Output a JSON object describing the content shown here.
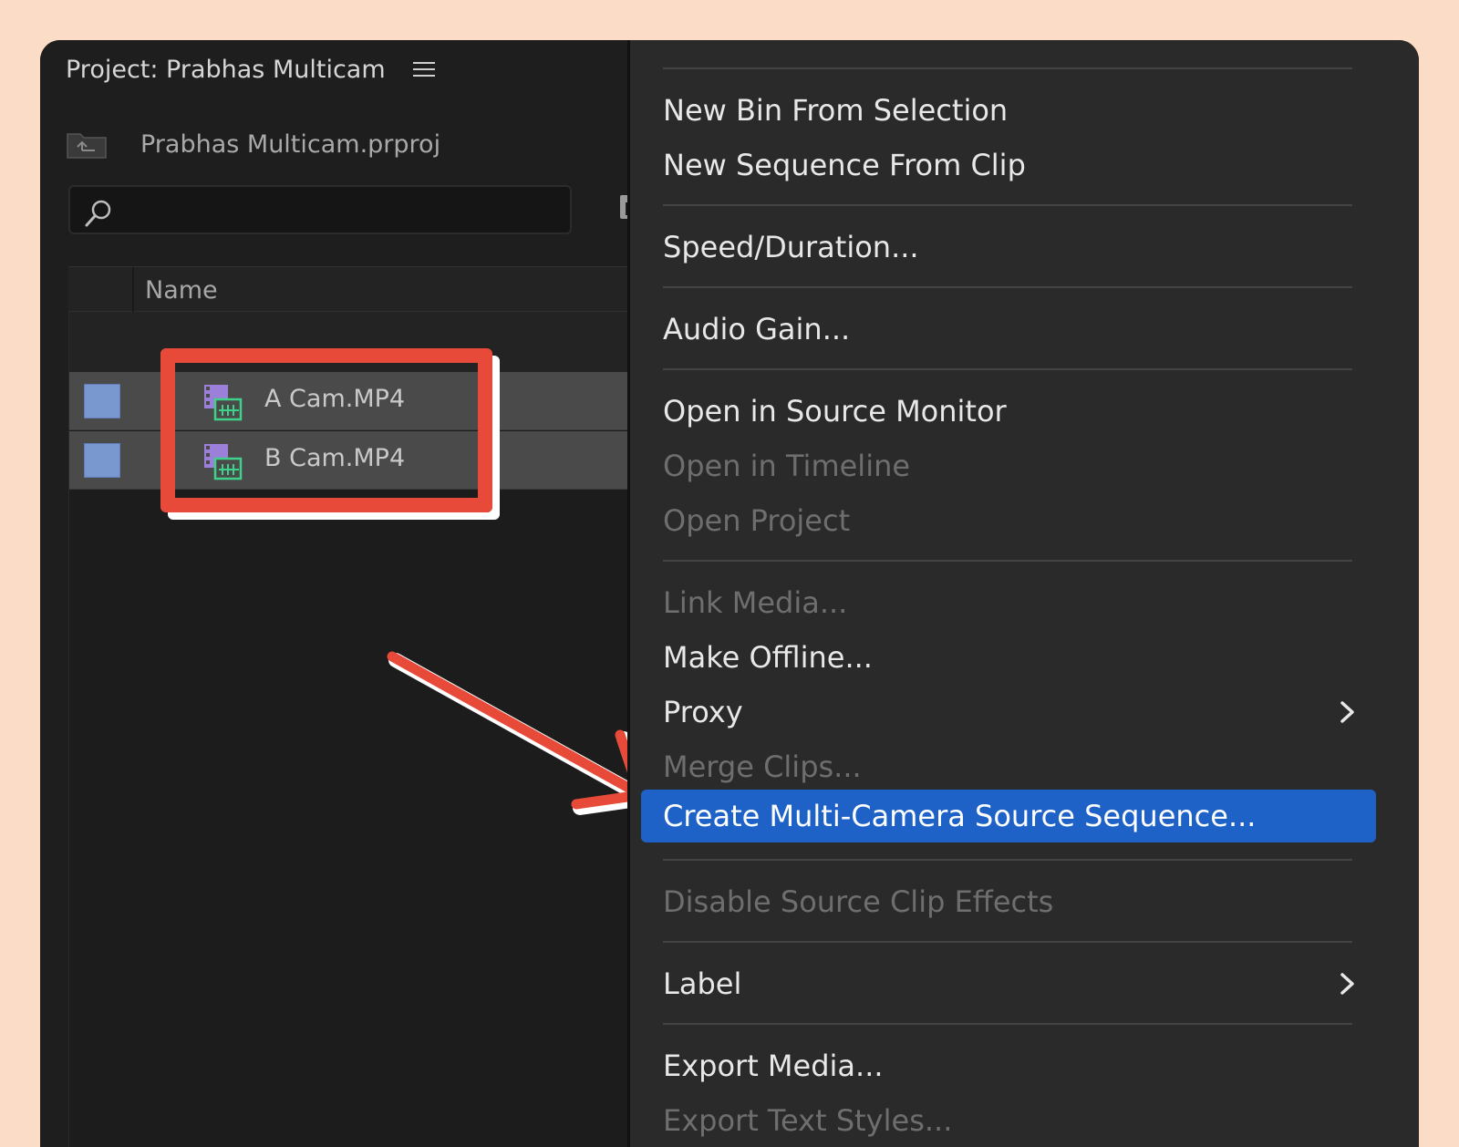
{
  "panel": {
    "title": "Project: Prabhas Multicam",
    "menu_icon": "hamburger-icon",
    "path": "Prabhas Multicam.prproj",
    "folder_icon": "folder-up-icon",
    "search_icon": "search-icon",
    "search_value": "",
    "column_name": "Name",
    "clips": [
      {
        "name": "A Cam.MP4",
        "label_color": "#7a98d0",
        "icon": "video-clip-icon"
      },
      {
        "name": "B Cam.MP4",
        "label_color": "#7a98d0",
        "icon": "video-clip-icon"
      }
    ]
  },
  "menu": {
    "items": [
      {
        "label": "New Bin From Selection",
        "enabled": true
      },
      {
        "label": "New Sequence From Clip",
        "enabled": true
      },
      {
        "label": "Speed/Duration...",
        "enabled": true
      },
      {
        "label": "Audio Gain...",
        "enabled": true
      },
      {
        "label": "Open in Source Monitor",
        "enabled": true
      },
      {
        "label": "Open in Timeline",
        "enabled": false
      },
      {
        "label": "Open Project",
        "enabled": false
      },
      {
        "label": "Link Media...",
        "enabled": false
      },
      {
        "label": "Make Offline...",
        "enabled": true
      },
      {
        "label": "Proxy",
        "enabled": true,
        "submenu": true
      },
      {
        "label": "Merge Clips...",
        "enabled": false
      },
      {
        "label": "Create Multi-Camera Source Sequence...",
        "enabled": true,
        "selected": true
      },
      {
        "label": "Disable Source Clip Effects",
        "enabled": false
      },
      {
        "label": "Label",
        "enabled": true,
        "submenu": true
      },
      {
        "label": "Export Media...",
        "enabled": true
      },
      {
        "label": "Export Text Styles...",
        "enabled": false
      }
    ]
  },
  "colors": {
    "highlight_box": "#e84a3a",
    "selection": "#1e62c7",
    "background": "#fbdcc7"
  }
}
